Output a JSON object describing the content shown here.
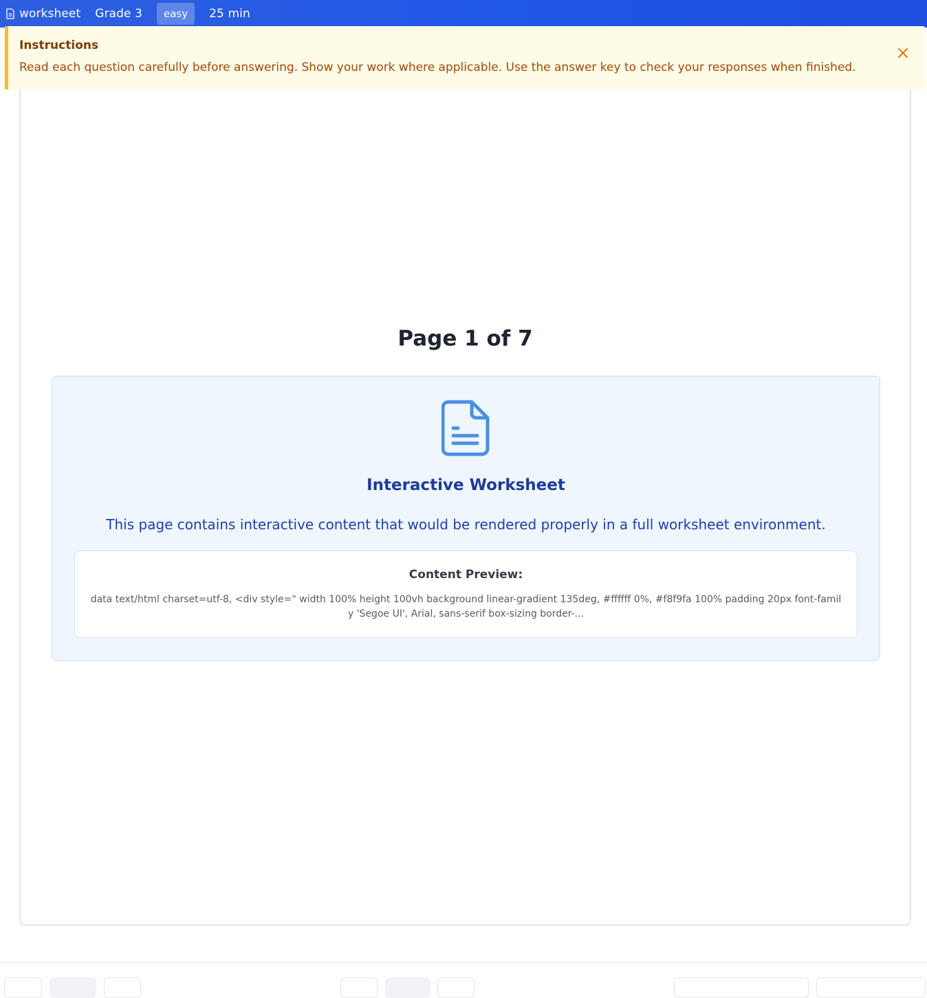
{
  "header": {
    "type_label": "worksheet",
    "grade_label": "Grade 3",
    "difficulty_badge": "easy",
    "duration_label": "25 min"
  },
  "instructions": {
    "title": "Instructions",
    "body": "Read each question carefully before answering. Show your work where applicable. Use the answer key to check your responses when finished."
  },
  "page": {
    "indicator": "Page 1 of 7",
    "current": 1,
    "total": 7
  },
  "interactive": {
    "heading": "Interactive Worksheet",
    "description": "This page contains interactive content that would be rendered properly in a full worksheet environment.",
    "preview_title": "Content Preview:",
    "preview_text": "data text/html charset=utf-8, <div style=\" width 100% height 100vh background linear-gradient 135deg, #ffffff 0%, #f8f9fa 100% padding 20px font-family 'Segoe UI', Arial, sans-serif box-sizing border-..."
  },
  "colors": {
    "header_bg": "#2058e3",
    "banner_bg": "#fefbe7",
    "banner_accent": "#f2c21b",
    "interactive_bg": "#eff6fd",
    "interactive_accent": "#4a90e2"
  }
}
